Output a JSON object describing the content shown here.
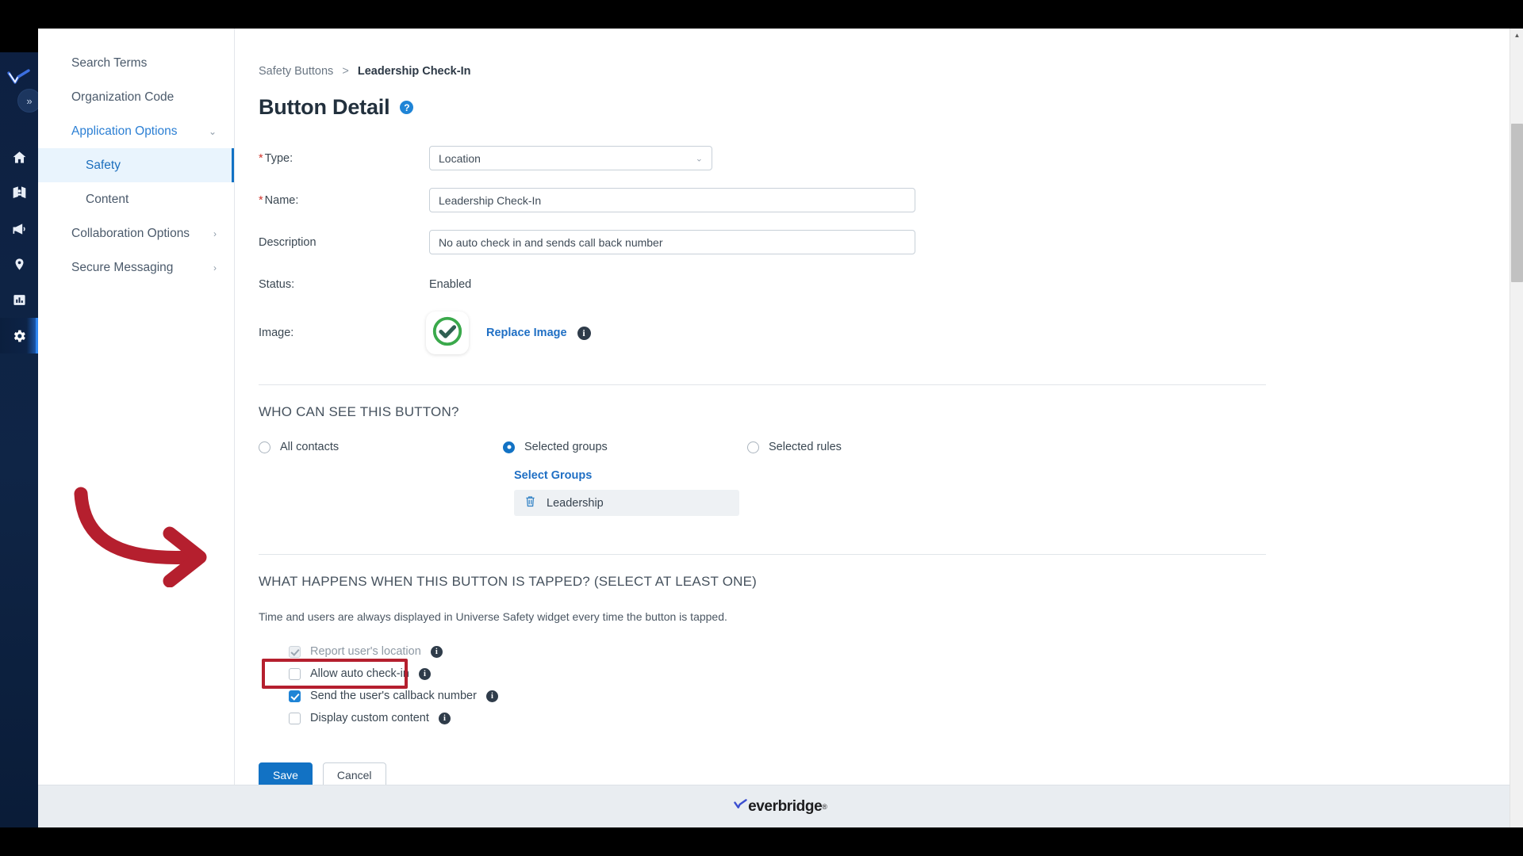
{
  "rail": {
    "collapse_label": "»",
    "logo_name": "everbridge-check-logo",
    "items": [
      {
        "name": "home-icon",
        "label": "Home",
        "active": false
      },
      {
        "name": "contacts-map-icon",
        "label": "Contacts",
        "active": false
      },
      {
        "name": "megaphone-icon",
        "label": "Notifications",
        "active": false
      },
      {
        "name": "location-pin-icon",
        "label": "Locations",
        "active": false
      },
      {
        "name": "reports-bar-icon",
        "label": "Reports",
        "active": false
      },
      {
        "name": "gear-icon",
        "label": "Settings",
        "active": true
      }
    ]
  },
  "sidebar": {
    "items": [
      {
        "label": "Search Terms",
        "type": "link",
        "expandable": false,
        "active": false
      },
      {
        "label": "Organization Code",
        "type": "link",
        "expandable": false,
        "active": false
      },
      {
        "label": "Application Options",
        "type": "section-open",
        "expandable": true,
        "caret": "⌄",
        "active": false
      },
      {
        "label": "Safety",
        "type": "sub",
        "expandable": false,
        "active": true
      },
      {
        "label": "Content",
        "type": "sub",
        "expandable": false,
        "active": false
      },
      {
        "label": "Collaboration Options",
        "type": "section",
        "expandable": true,
        "caret": "›",
        "active": false
      },
      {
        "label": "Secure Messaging",
        "type": "section",
        "expandable": true,
        "caret": "›",
        "active": false
      }
    ]
  },
  "breadcrumb": {
    "parent": "Safety Buttons",
    "separator": ">",
    "current": "Leadership Check-In"
  },
  "page": {
    "title": "Button Detail",
    "help_icon": "?"
  },
  "form": {
    "type": {
      "label": "Type:",
      "required_mark": "*",
      "value": "Location",
      "caret": "⌄"
    },
    "name": {
      "label": "Name:",
      "required_mark": "*",
      "value": "Leadership Check-In"
    },
    "description": {
      "label": "Description",
      "value": "No auto check in and sends call back number"
    },
    "status": {
      "label": "Status:",
      "value": "Enabled"
    },
    "image": {
      "label": "Image:",
      "thumb_icon": "green-check-circle-icon",
      "replace_label": "Replace Image",
      "info_icon": "i"
    }
  },
  "visibility": {
    "heading": "WHO CAN SEE THIS BUTTON?",
    "options": [
      {
        "label": "All contacts",
        "selected": false
      },
      {
        "label": "Selected groups",
        "selected": true
      },
      {
        "label": "Selected rules",
        "selected": false
      }
    ],
    "select_groups_label": "Select Groups",
    "groups": [
      {
        "label": "Leadership",
        "delete_icon": "trash-icon"
      }
    ]
  },
  "actions": {
    "heading": "WHAT HAPPENS WHEN THIS BUTTON IS TAPPED? (SELECT AT LEAST ONE)",
    "helper": "Time and users are always displayed in Universe Safety widget every time the button is tapped.",
    "checkboxes": [
      {
        "label": "Report user's location",
        "checked": true,
        "disabled": true,
        "info_icon": "i"
      },
      {
        "label": "Allow auto check-in",
        "checked": false,
        "disabled": false,
        "info_icon": "i"
      },
      {
        "label": "Send the user's callback number",
        "checked": true,
        "disabled": false,
        "info_icon": "i",
        "highlighted": true
      },
      {
        "label": "Display custom content",
        "checked": false,
        "disabled": false,
        "info_icon": "i"
      }
    ]
  },
  "buttons": {
    "save": "Save",
    "cancel": "Cancel"
  },
  "footer": {
    "brand": "everbridge",
    "trademark": "®"
  },
  "scrollbar": {
    "up_arrow": "▲",
    "down_arrow": "▼"
  },
  "annotations": {
    "arrow_color": "#b51f2e",
    "highlight_color": "#b51f2e",
    "target": "Send the user's callback number"
  },
  "colors": {
    "accent_blue": "#1272c4",
    "link_blue": "#1f6fc4",
    "rail_navy": "#0d2041",
    "green_check": "#3aa94b",
    "annotation_red": "#b51f2e"
  }
}
